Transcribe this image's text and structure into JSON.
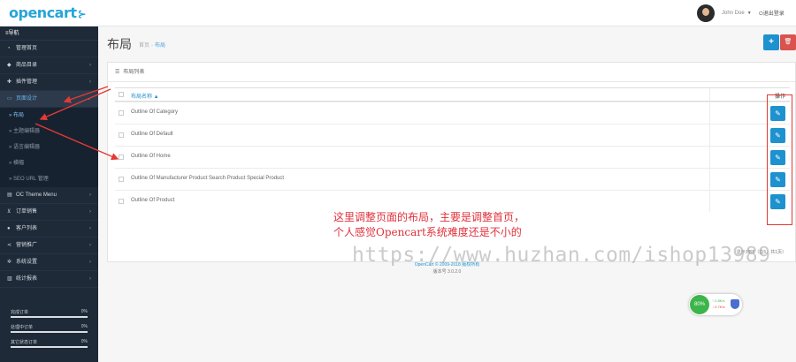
{
  "header": {
    "logo": "opencart",
    "user_name": "John Doe",
    "logout_label": "退出登录"
  },
  "sidebar": {
    "toggle_label": "导航",
    "items": [
      {
        "label": "管理首页",
        "icon": "dashboard-icon",
        "has_children": false
      },
      {
        "label": "商品目录",
        "icon": "tag-icon",
        "has_children": true
      },
      {
        "label": "插件管理",
        "icon": "puzzle-icon",
        "has_children": true
      },
      {
        "label": "页面设计",
        "icon": "monitor-icon",
        "has_children": true,
        "active": true
      },
      {
        "label": "OC Theme Menu",
        "icon": "bars-icon",
        "has_children": true
      },
      {
        "label": "订单销售",
        "icon": "cart-icon",
        "has_children": true
      },
      {
        "label": "客户列表",
        "icon": "user-icon",
        "has_children": true
      },
      {
        "label": "营销推广",
        "icon": "share-icon",
        "has_children": true
      },
      {
        "label": "系统设置",
        "icon": "cog-icon",
        "has_children": true
      },
      {
        "label": "统计报表",
        "icon": "chart-icon",
        "has_children": true
      }
    ],
    "sub_items": [
      {
        "label": "» 布局",
        "current": true
      },
      {
        "label": "» 主题编辑器",
        "current": false
      },
      {
        "label": "» 语言编辑器",
        "current": false
      },
      {
        "label": "» 横幅",
        "current": false
      },
      {
        "label": "» SEO URL 管理",
        "current": false
      }
    ],
    "stats": [
      {
        "label": "完成订单",
        "value": "0%"
      },
      {
        "label": "处理中订单",
        "value": "0%"
      },
      {
        "label": "其它状态订单",
        "value": "0%"
      }
    ]
  },
  "page": {
    "title": "布局",
    "breadcrumb_home": "首页",
    "breadcrumb_current": "布局",
    "add_button": "+",
    "delete_button": "🗑",
    "panel_title": "布局列表",
    "column_name": "布局名称 ▲",
    "column_action": "操作",
    "rows": [
      "Outline Of Category",
      "Outline Of Default",
      "Outline Of Home",
      "Outline Of Manufacturer Product Search Product Special Product",
      "Outline Of Product"
    ],
    "pagination_text": "显示1到5（总5，共1页）"
  },
  "footer": {
    "line1": "OpenCart © 2009-2018 版权所有",
    "line2": "版本号 3.0.2.0"
  },
  "annotation": {
    "line1": "这里调整页面的布局，主要是调整首页，",
    "line2": "个人感觉Opencart系统难度还是不小的",
    "watermark": "https://www.huzhan.com/ishop13989",
    "highlight_color": "#e53935"
  },
  "widget": {
    "percent": "80%",
    "up_rate": "↑ 2.8K/s",
    "down_rate": "↓ 0.7K/s"
  }
}
